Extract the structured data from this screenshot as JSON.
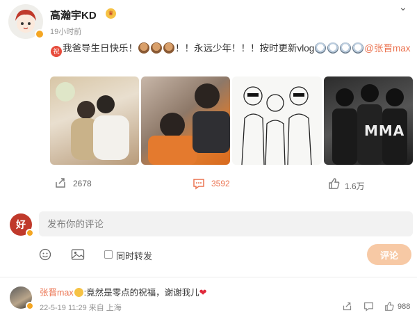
{
  "post": {
    "username": "高瀚宇KD",
    "timestamp": "19小时前",
    "text_before": "我爸导生日快乐！",
    "text_mid": "！！永远少年！！！按时更新vlog",
    "mention": "@张晋max",
    "images": [
      "photo-1",
      "photo-2",
      "photo-3",
      "photo-4"
    ],
    "image4_text": "MMA"
  },
  "actions": {
    "repost_count": "2678",
    "comment_count": "3592",
    "like_count": "1.6万"
  },
  "composer": {
    "placeholder": "发布你的评论",
    "avatar_char": "好",
    "repost_label": "同时转发",
    "submit_label": "评论"
  },
  "reply": {
    "username": "张晋max",
    "text": ":竟然是零点的祝福，谢谢我儿",
    "meta": "22-5-19 11:29 来自 上海",
    "like_count": "988"
  },
  "colors": {
    "accent": "#eb7350",
    "submit_bg": "#f7c9a5",
    "badge": "#f4a623"
  },
  "icons": [
    "chevron-down-icon",
    "repost-icon",
    "comment-icon",
    "like-icon",
    "emoji-icon",
    "image-icon",
    "heart-icon"
  ]
}
